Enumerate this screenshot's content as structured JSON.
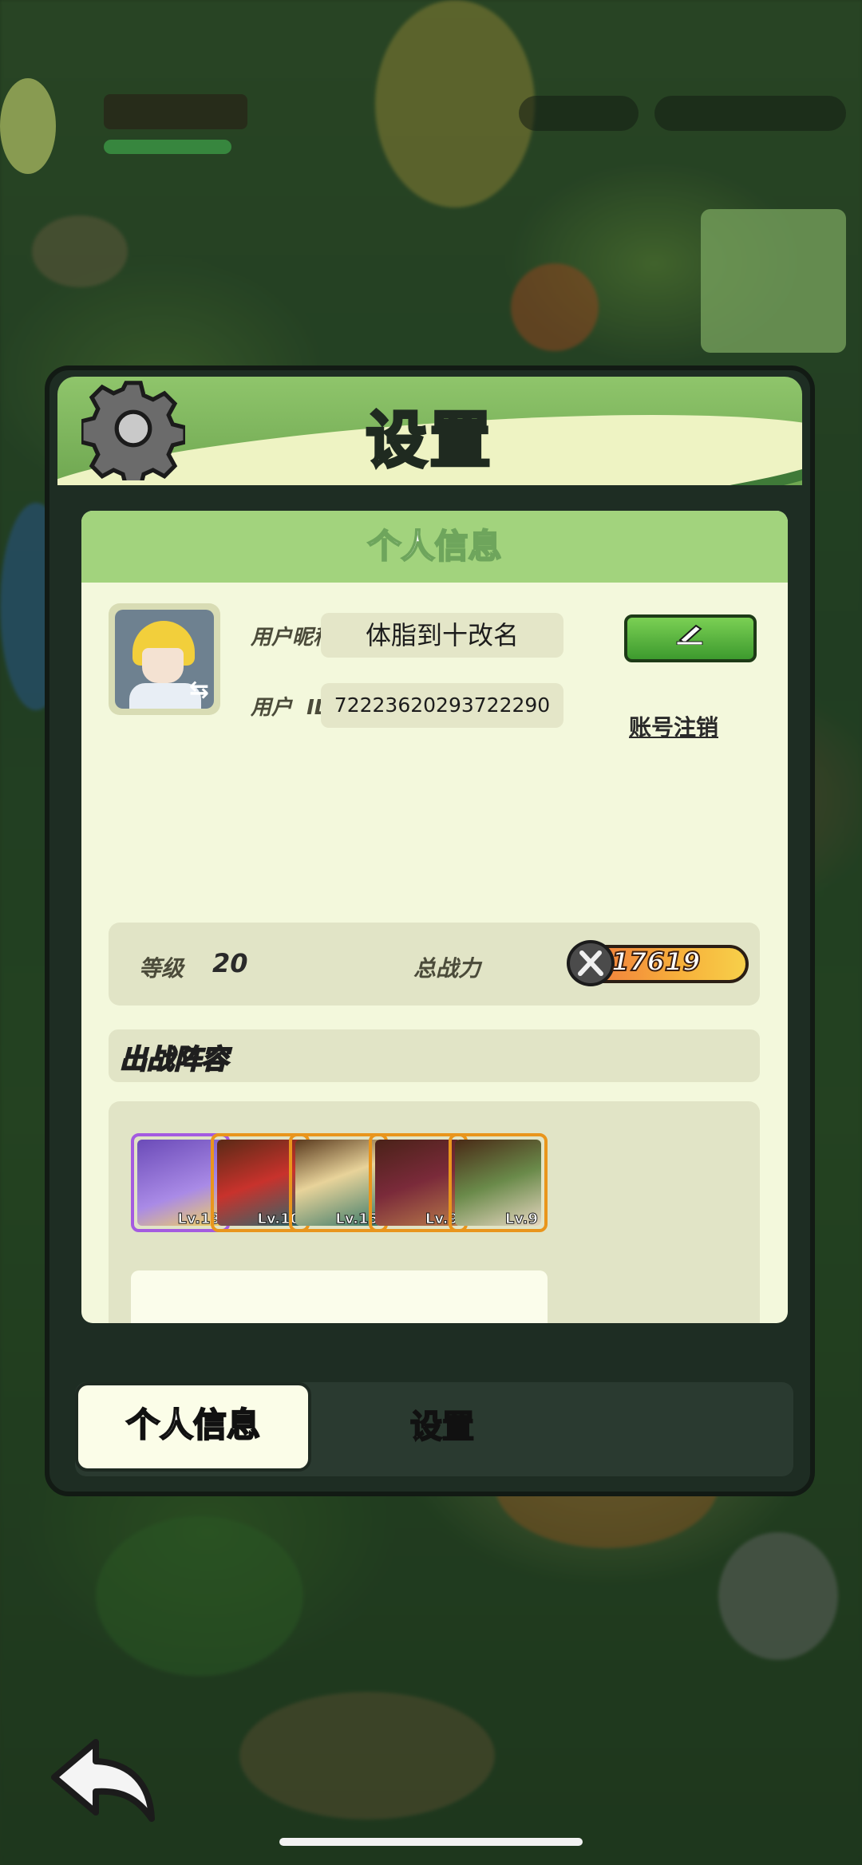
{
  "panel": {
    "title": "设置"
  },
  "profile": {
    "section_title": "个人信息",
    "nickname_label": "用户昵称",
    "nickname": "体脂到十改名",
    "id_label": "用户  ID",
    "user_id": "72223620293722290",
    "account_link": "账号注销",
    "level_label": "等级",
    "level": "20",
    "power_label": "总战力",
    "power": "17619"
  },
  "lineup": {
    "title": "出战阵容",
    "heroes": [
      {
        "level": "Lv.13",
        "rarity_color": "#a45be0"
      },
      {
        "level": "Lv.10",
        "rarity_color": "#e9951c"
      },
      {
        "level": "Lv.15",
        "rarity_color": "#e9951c"
      },
      {
        "level": "Lv.9",
        "rarity_color": "#e9951c"
      },
      {
        "level": "Lv.9",
        "rarity_color": "#e9951c"
      }
    ],
    "empty_slots": 5
  },
  "tabs": [
    {
      "label": "个人信息",
      "active": true
    },
    {
      "label": "设置",
      "active": false
    }
  ],
  "icons": [
    "gear-icon",
    "edit-pen-icon",
    "swap-avatar-icon",
    "sword-power-icon",
    "back-arrow-icon"
  ]
}
